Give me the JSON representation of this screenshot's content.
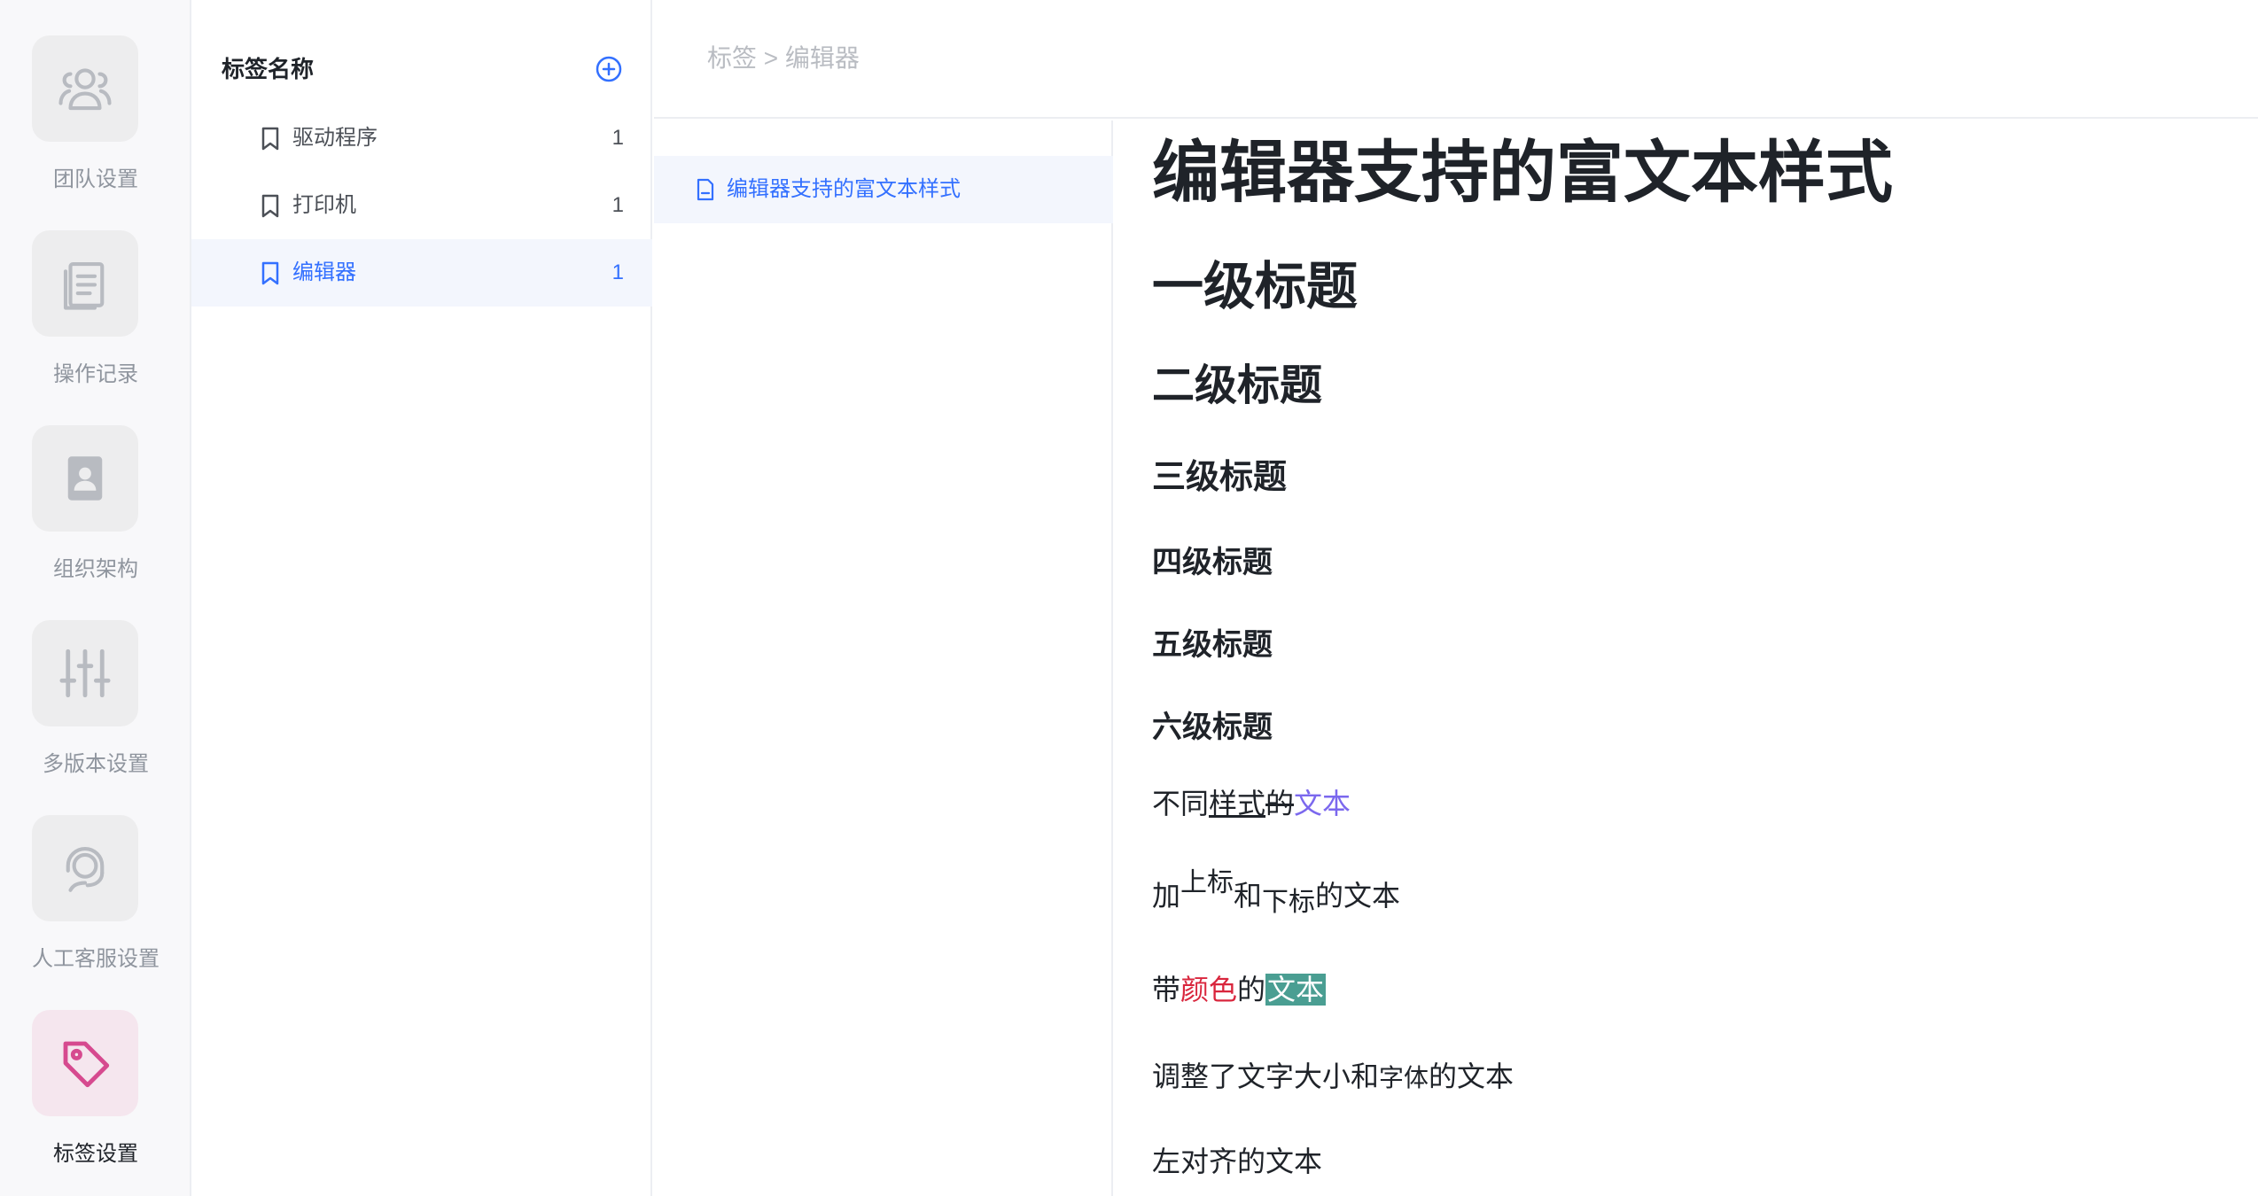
{
  "colors": {
    "accent": "#3370ff",
    "tag_active": "#d64a8f",
    "highlight_bg": "#4a9e92",
    "red_text": "#d9263d",
    "purple_text": "#7b68ee"
  },
  "rail": {
    "items": [
      {
        "label": "团队设置",
        "icon": "team-icon"
      },
      {
        "label": "操作记录",
        "icon": "document-log-icon"
      },
      {
        "label": "组织架构",
        "icon": "contact-book-icon"
      },
      {
        "label": "多版本设置",
        "icon": "sliders-icon"
      },
      {
        "label": "人工客服设置",
        "icon": "headset-agent-icon"
      },
      {
        "label": "标签设置",
        "icon": "tag-icon"
      }
    ]
  },
  "tags": {
    "title": "标签名称",
    "items": [
      {
        "name": "驱动程序",
        "count": "1"
      },
      {
        "name": "打印机",
        "count": "1"
      },
      {
        "name": "编辑器",
        "count": "1"
      }
    ]
  },
  "breadcrumb": "标签 > 编辑器",
  "docs": {
    "items": [
      {
        "name": "编辑器支持的富文本样式"
      }
    ]
  },
  "article": {
    "title": "编辑器支持的富文本样式",
    "h1": "一级标题",
    "h2": "二级标题",
    "h3": "三级标题",
    "h4": "四级标题",
    "h5": "五级标题",
    "h6": "六级标题",
    "p1": {
      "a": "不同",
      "b": "样式",
      "c": "的",
      "d": "文本"
    },
    "p2": {
      "a": "加",
      "b": "上标",
      "c": "和",
      "d": "下标",
      "e": "的文本"
    },
    "p3": {
      "a": "带",
      "b": "颜色",
      "c": "的",
      "d": "文本"
    },
    "p4": {
      "a": "调整了文字大小和",
      "b": "字体",
      "c": "的文本"
    },
    "p5": "左对齐的文本"
  }
}
